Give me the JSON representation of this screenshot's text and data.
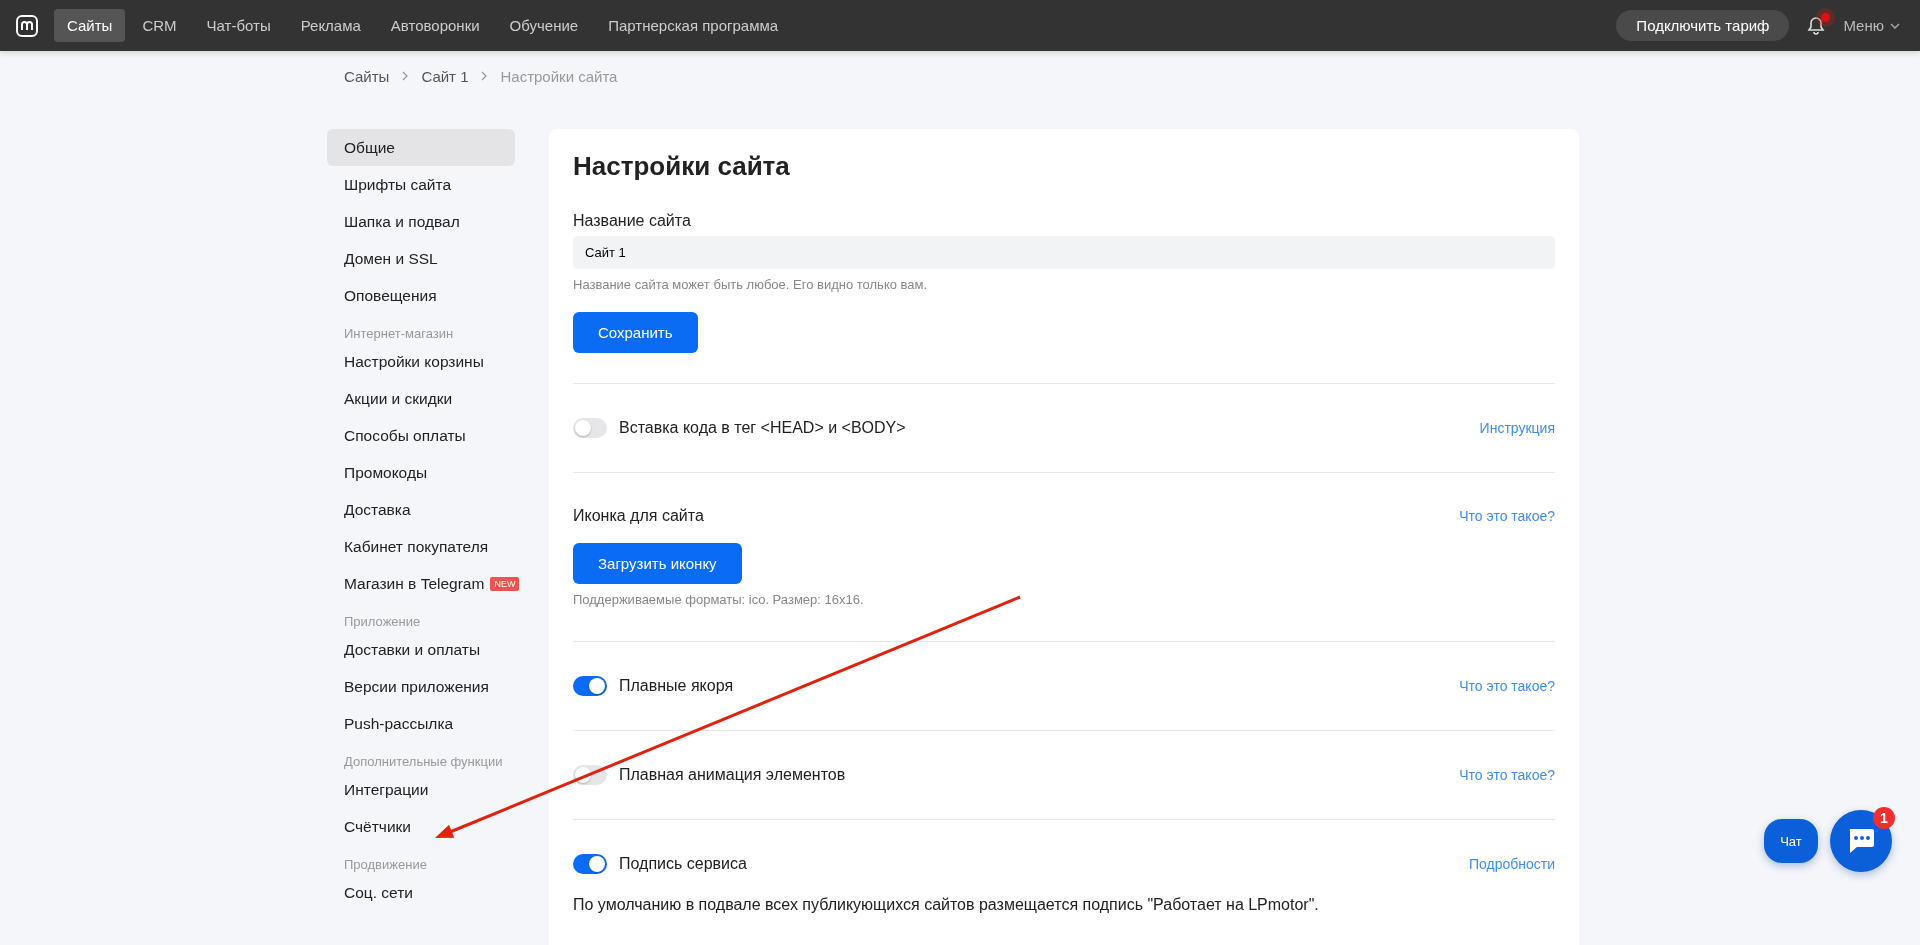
{
  "top_nav": {
    "tabs": [
      {
        "label": "Сайты",
        "selected": true
      },
      {
        "label": "CRM",
        "selected": false
      },
      {
        "label": "Чат-боты",
        "selected": false
      },
      {
        "label": "Реклама",
        "selected": false
      },
      {
        "label": "Автоворонки",
        "selected": false
      },
      {
        "label": "Обучение",
        "selected": false
      },
      {
        "label": "Партнерская программа",
        "selected": false
      }
    ],
    "tariff_button": "Подключить тариф",
    "notifications": {
      "unread": true
    },
    "menu": "Меню"
  },
  "breadcrumbs": [
    {
      "label": "Сайты",
      "current": false
    },
    {
      "label": "Сайт 1",
      "current": false
    },
    {
      "label": "Настройки сайта",
      "current": true
    }
  ],
  "sidebar": {
    "groups": [
      {
        "items": [
          {
            "label": "Общие",
            "selected": true
          },
          {
            "label": "Шрифты сайта",
            "selected": false
          },
          {
            "label": "Шапка и подвал",
            "selected": false
          },
          {
            "label": "Домен и SSL",
            "selected": false
          },
          {
            "label": "Оповещения",
            "selected": false
          }
        ]
      },
      {
        "title": "Интернет-магазин",
        "items": [
          {
            "label": "Настройки корзины",
            "selected": false
          },
          {
            "label": "Акции и скидки",
            "selected": false
          },
          {
            "label": "Способы оплаты",
            "selected": false
          },
          {
            "label": "Промокоды",
            "selected": false
          },
          {
            "label": "Доставка",
            "selected": false
          },
          {
            "label": "Кабинет покупателя",
            "selected": false
          },
          {
            "label": "Магазин в Telegram",
            "selected": false,
            "badge": "NEW"
          }
        ]
      },
      {
        "title": "Приложение",
        "items": [
          {
            "label": "Доставки и оплаты",
            "selected": false
          },
          {
            "label": "Версии приложения",
            "selected": false
          },
          {
            "label": "Push-рассылка",
            "selected": false
          }
        ]
      },
      {
        "title": "Дополнительные функции",
        "items": [
          {
            "label": "Интеграции",
            "selected": false
          },
          {
            "label": "Счётчики",
            "selected": false
          }
        ]
      },
      {
        "title": "Продвижение",
        "items": [
          {
            "label": "Соц. сети",
            "selected": false
          }
        ]
      }
    ]
  },
  "settings": {
    "title": "Настройки сайта",
    "site_name": {
      "label": "Название сайта",
      "value": "Сайт 1",
      "hint": "Название сайта может быть любое. Его видно только вам.",
      "button": "Сохранить"
    },
    "sections": [
      {
        "kind": "toggle",
        "label": "Вставка кода в тег <HEAD> и <BODY>",
        "on": false,
        "link": "Инструкция"
      },
      {
        "kind": "upload",
        "label": "Иконка для сайта",
        "link": "Что это такое?",
        "button": "Загрузить иконку",
        "hint": "Поддерживаемые форматы: ico. Размер: 16x16."
      },
      {
        "kind": "toggle",
        "label": "Плавные якоря",
        "on": true,
        "link": "Что это такое?"
      },
      {
        "kind": "toggle",
        "label": "Плавная анимация элементов",
        "on": false,
        "link": "Что это такое?"
      },
      {
        "kind": "toggle",
        "label": "Подпись сервиса",
        "on": true,
        "link": "Подробности",
        "description": "По умолчанию в подвале всех публикующихся сайтов размещается подпись \"Работает на LPmotor\"."
      }
    ]
  },
  "chat": {
    "button": "Чат",
    "badge": "1"
  }
}
